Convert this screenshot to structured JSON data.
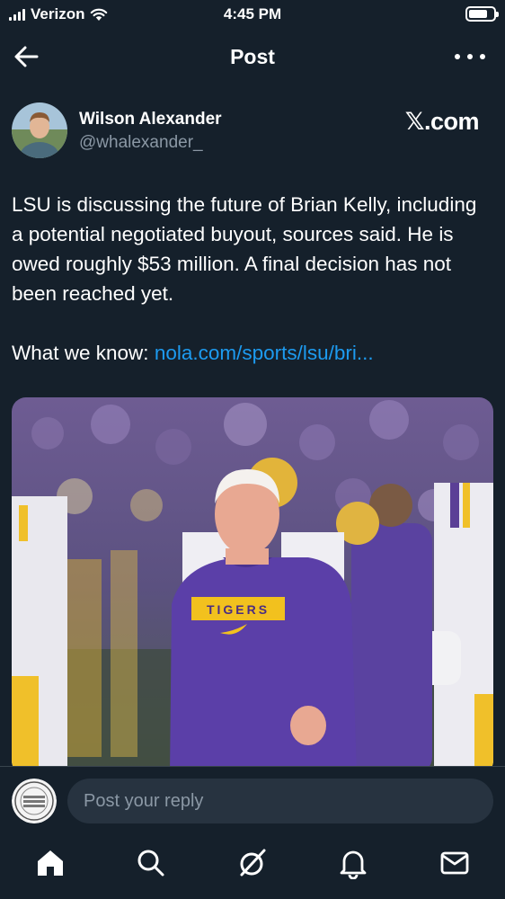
{
  "status_bar": {
    "carrier": "Verizon",
    "time": "4:45 PM",
    "battery_level": 0.75
  },
  "header": {
    "title": "Post",
    "back_icon": "arrow-left-icon",
    "more_icon": "more-horizontal-icon"
  },
  "author": {
    "name": "Wilson Alexander",
    "handle": "@whalexander_",
    "source": "𝕏.com"
  },
  "post": {
    "text": "LSU is discussing the future of Brian Kelly, including a potential negotiated buyout, sources said. He is owed roughly $53 million. A final decision has not been reached yet.",
    "what_we_know_label": "What we know:",
    "link_text": "nola.com/sports/lsu/bri...",
    "media_alt": "Coach in purple TIGERS hoodie walking with players",
    "hoodie_text": "TIGERS"
  },
  "reply": {
    "placeholder": "Post your reply"
  },
  "tabs": [
    {
      "name": "home",
      "icon": "home-icon"
    },
    {
      "name": "search",
      "icon": "search-icon"
    },
    {
      "name": "grok",
      "icon": "grok-icon"
    },
    {
      "name": "notifications",
      "icon": "bell-icon"
    },
    {
      "name": "messages",
      "icon": "mail-icon"
    }
  ],
  "colors": {
    "background": "#15202b",
    "link": "#1d9bf0",
    "secondary_text": "#8b98a5",
    "input_bg": "#273340"
  }
}
